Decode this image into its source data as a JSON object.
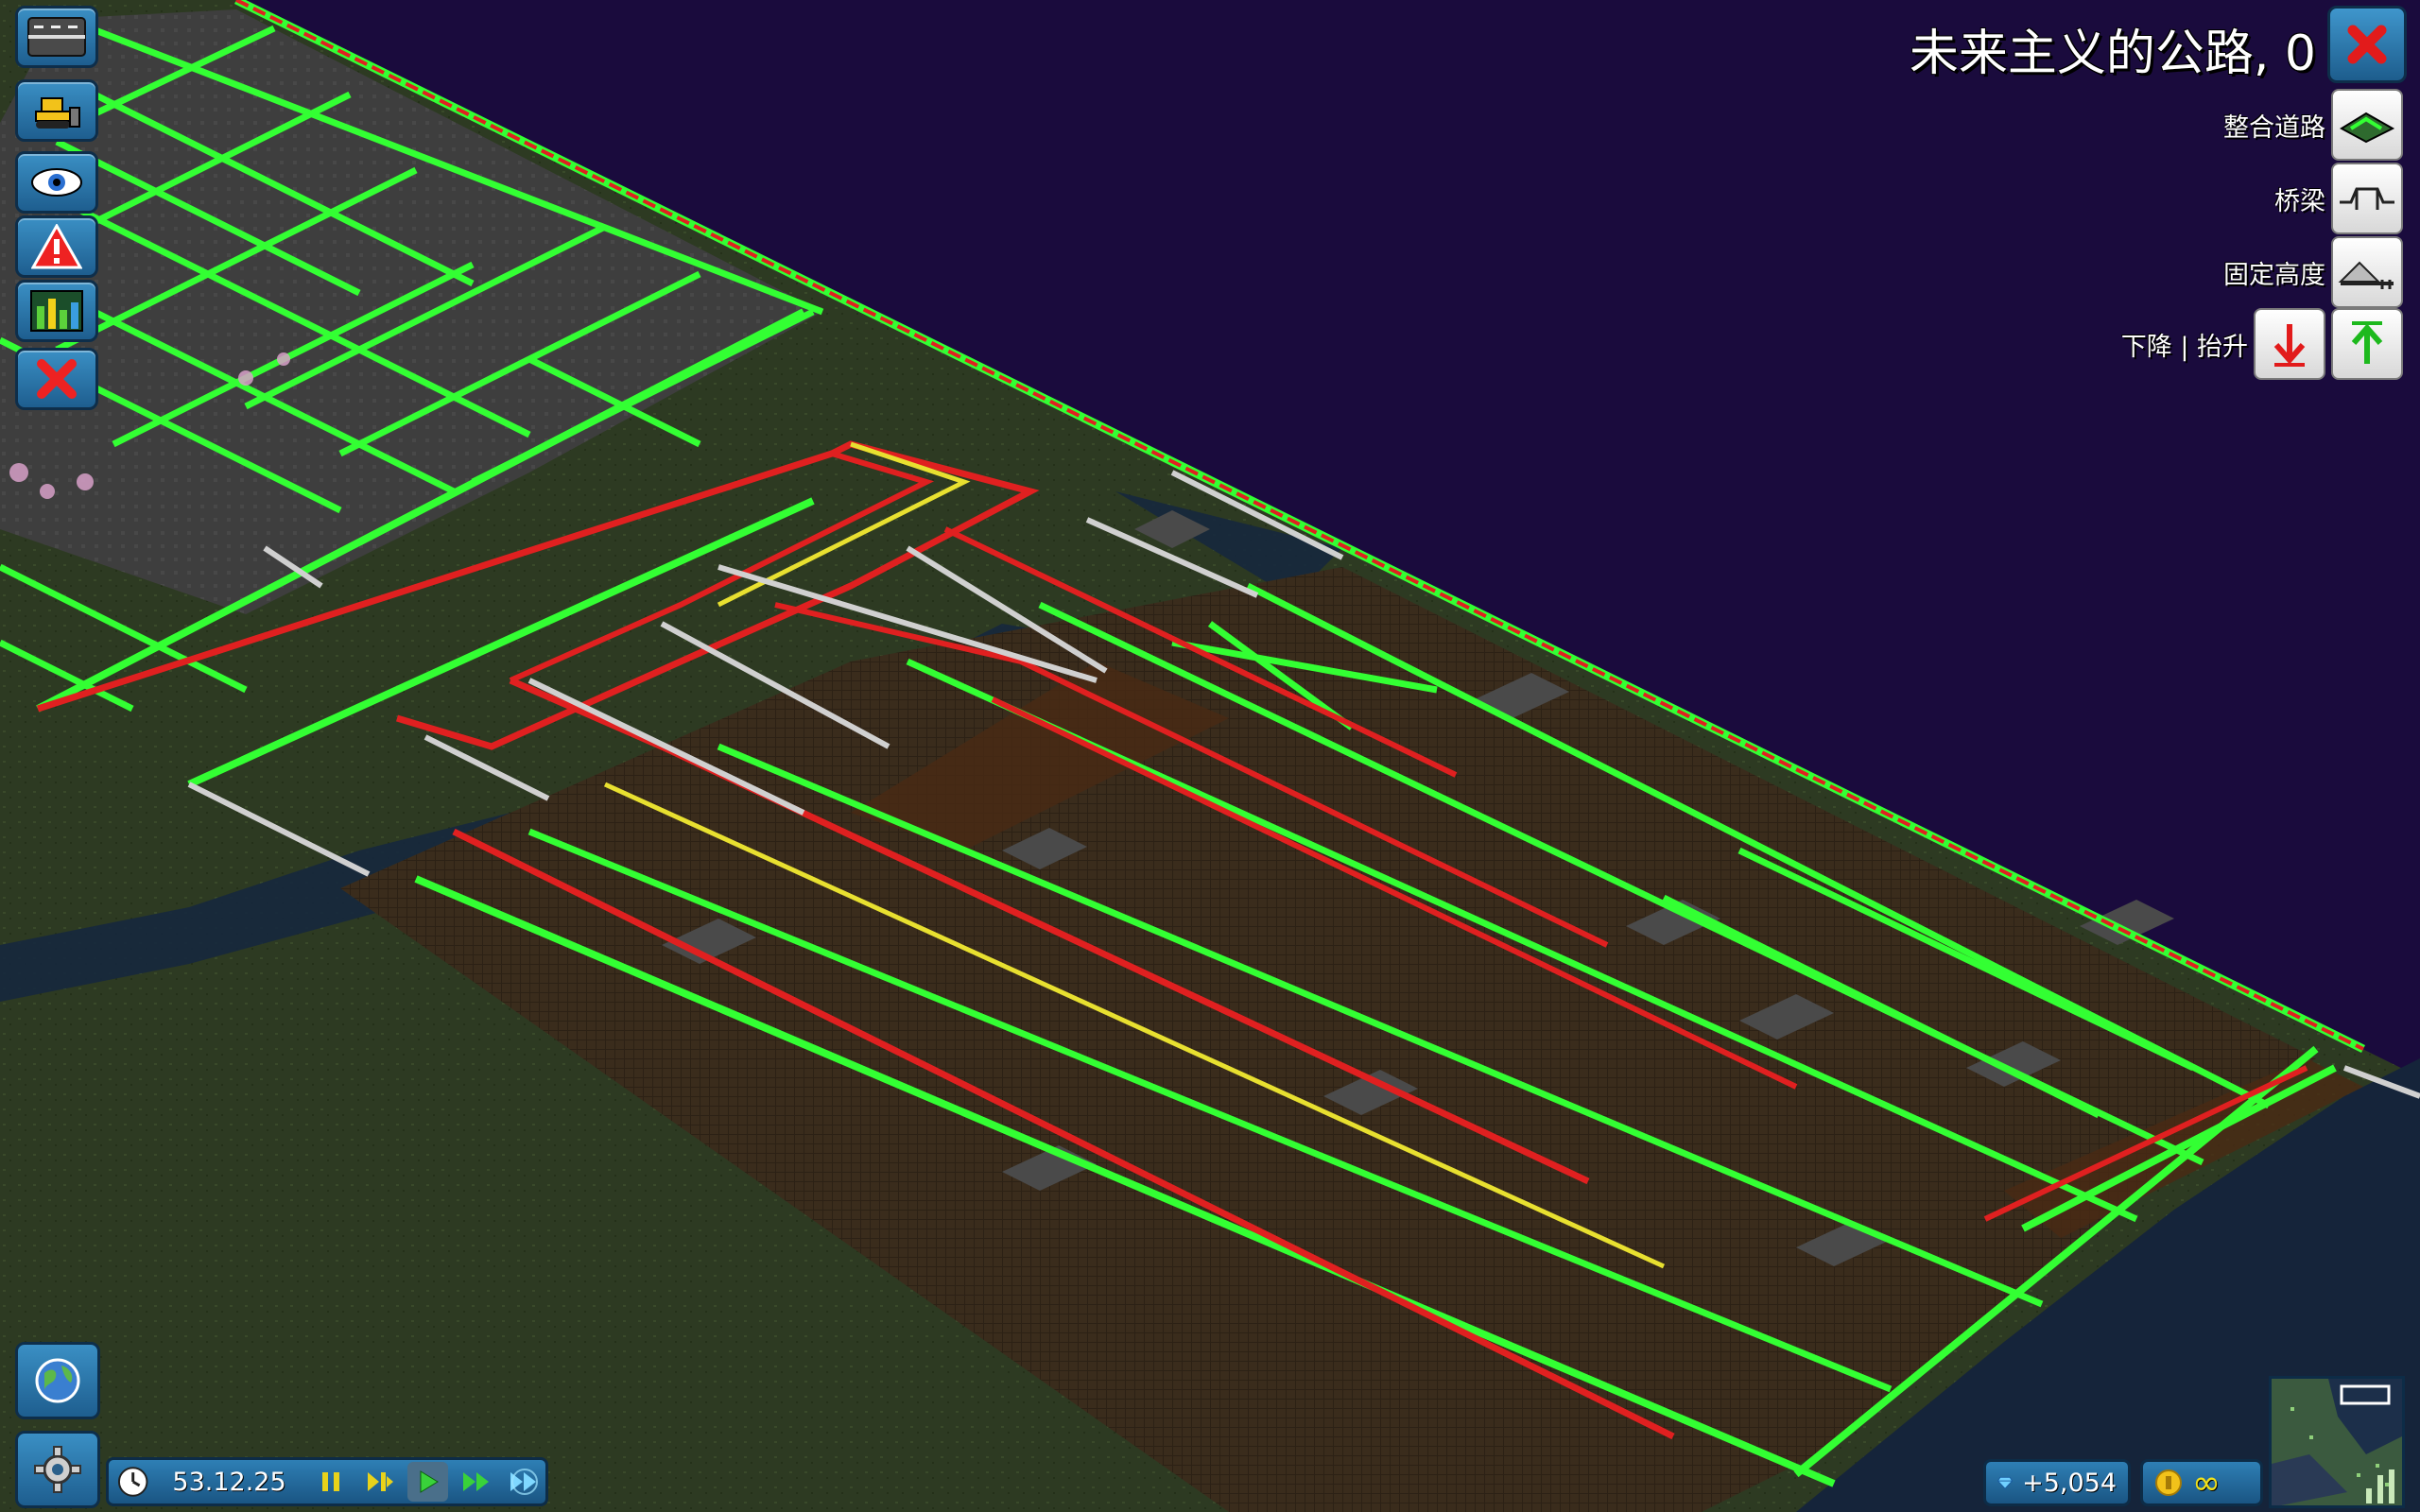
{
  "panel": {
    "title": "未来主义的公路, 0",
    "options": [
      {
        "label": "整合道路",
        "icon": "merge-road-icon"
      },
      {
        "label": "桥梁",
        "icon": "bridge-icon"
      },
      {
        "label": "固定高度",
        "icon": "fixed-height-icon"
      }
    ],
    "height_label": "下降 | 抬升",
    "lower_icon": "arrow-down-icon",
    "raise_icon": "arrow-up-icon"
  },
  "left_toolbar": [
    {
      "name": "road-menu-icon"
    },
    {
      "name": "bulldozer-icon"
    },
    {
      "name": "view-eye-icon"
    },
    {
      "name": "warning-icon"
    },
    {
      "name": "chart-bars-icon"
    },
    {
      "name": "close-x-icon"
    }
  ],
  "bottom": {
    "date": "53.12.25",
    "speed_controls": [
      "pause-icon",
      "slow-icon",
      "play-icon",
      "fast-icon",
      "fastest-icon"
    ],
    "diamonds": "+5,054",
    "money": "∞"
  },
  "colors": {
    "sky": "#1a0b3d",
    "road_green": "#33ff33",
    "traffic_red": "#e02020",
    "traffic_yellow": "#e8e030",
    "ground": "#2f3a22",
    "dirt": "#3a2a1a",
    "water": "#15243a",
    "building_gray": "#3c3c3c"
  }
}
